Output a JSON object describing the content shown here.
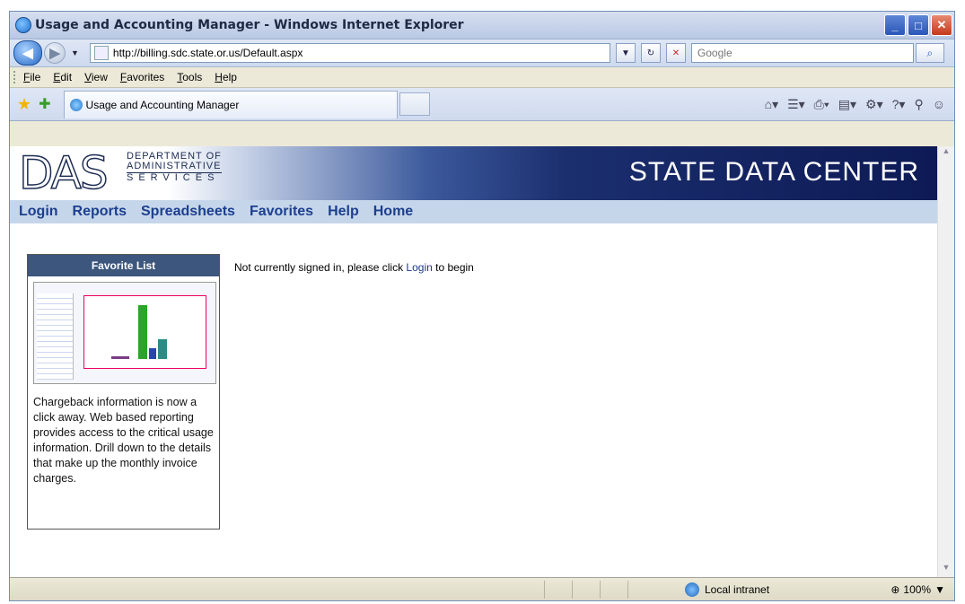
{
  "window": {
    "title": "Usage and Accounting Manager - Windows Internet Explorer"
  },
  "address_bar": {
    "url": "http://billing.sdc.state.or.us/Default.aspx"
  },
  "search": {
    "placeholder": "Google"
  },
  "menu": {
    "items": [
      "File",
      "Edit",
      "View",
      "Favorites",
      "Tools",
      "Help"
    ]
  },
  "tab": {
    "title": "Usage and Accounting Manager"
  },
  "banner": {
    "logo_mark": "DAS",
    "logo_lines": [
      "DEPARTMENT OF",
      "ADMINISTRATIVE",
      "SERVICES"
    ],
    "title": "STATE DATA CENTER"
  },
  "nav": {
    "links": [
      "Login",
      "Reports",
      "Spreadsheets",
      "Favorites",
      "Help",
      "Home"
    ]
  },
  "favorites": {
    "header": "Favorite List",
    "description": "Chargeback information is now a click away. Web based reporting provides access to the critical usage information. Drill down to the details that make up the monthly invoice charges."
  },
  "message": {
    "prefix": "Not currently signed in, please click ",
    "link": "Login",
    "suffix": " to begin"
  },
  "status": {
    "zone": "Local intranet",
    "zoom": "100%"
  },
  "colors": {
    "nav_link": "#1c3f8f",
    "fav_header_bg": "#3c567e",
    "banner_dark": "#0d1a55"
  }
}
